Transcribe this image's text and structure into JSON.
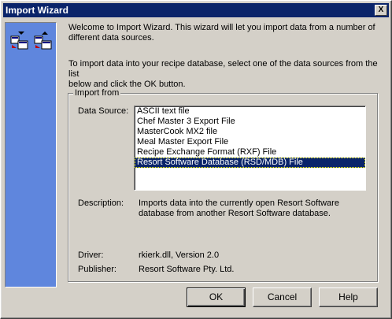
{
  "window": {
    "title": "Import Wizard",
    "close_glyph": "X"
  },
  "intro": {
    "line1": "Welcome to Import Wizard.  This wizard will let you import data from a number of",
    "line2": "different data sources.",
    "line3": "To import data into your recipe database, select one of the data sources from the list",
    "line4": "below and click the OK button."
  },
  "import_from": {
    "legend": "Import from",
    "data_source_label": "Data Source:",
    "data_sources": [
      "ASCII text file",
      "Chef Master 3 Export File",
      "MasterCook MX2 file",
      "Meal Master Export File",
      "Recipe Exchange Format (RXF) File",
      "Resort Software Database (RSD/MDB) File"
    ],
    "selected_index": 5,
    "description_label": "Description:",
    "description_line1": "Imports data into the currently open Resort Software",
    "description_line2": "database from another Resort Software database.",
    "driver_label": "Driver:",
    "driver_value": "rkierk.dll,  Version 2.0",
    "publisher_label": "Publisher:",
    "publisher_value": "Resort Software Pty. Ltd."
  },
  "buttons": {
    "ok": "OK",
    "cancel": "Cancel",
    "help": "Help"
  },
  "sidebar": {
    "icon": "wizard-import-icon",
    "color": "#5f86dd"
  },
  "colors": {
    "titlebar": "#0a246a",
    "selection": "#0a246a",
    "face": "#d4d0c8"
  }
}
